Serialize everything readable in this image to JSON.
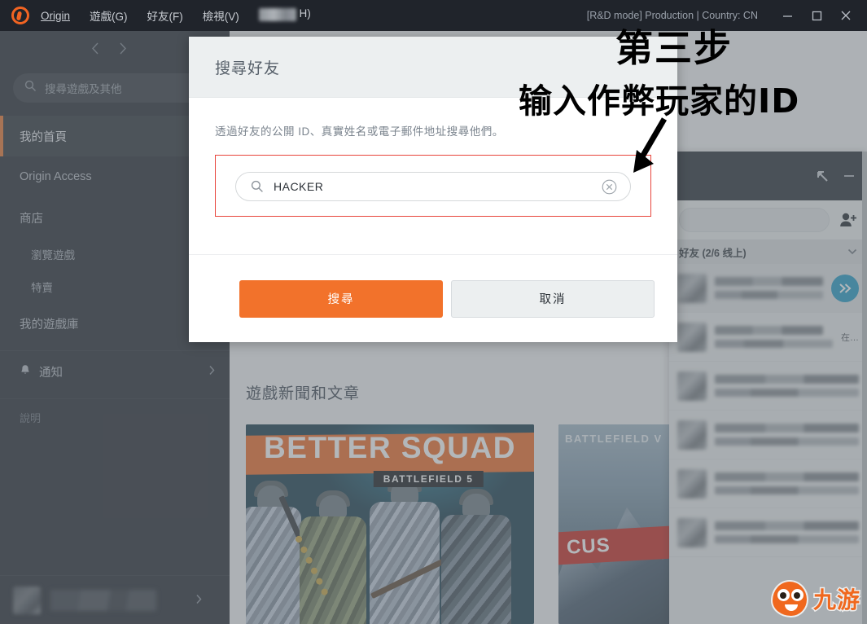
{
  "titlebar": {
    "app_name": "Origin",
    "menus": [
      {
        "label": "Origin",
        "accel": ""
      },
      {
        "label": "遊戲(G)",
        "accel": "G"
      },
      {
        "label": "好友(F)",
        "accel": "F"
      },
      {
        "label": "檢視(V)",
        "accel": "V"
      }
    ],
    "menu_blurred_tail": "H)",
    "status": "[R&D mode] Production | Country: CN",
    "window_controls": {
      "minimize": "minimize-icon",
      "maximize": "maximize-icon",
      "close": "close-icon"
    }
  },
  "sidebar": {
    "nav_back": "chevron-left-icon",
    "nav_forward": "chevron-right-icon",
    "search_placeholder": "搜尋遊戲及其他",
    "items": [
      {
        "label": "我的首頁",
        "active": true,
        "sub": false
      },
      {
        "label": "Origin Access",
        "active": false,
        "sub": false
      },
      {
        "label": "商店",
        "active": false,
        "sub": false
      },
      {
        "label": "瀏覽遊戲",
        "active": false,
        "sub": true
      },
      {
        "label": "特賣",
        "active": false,
        "sub": true
      },
      {
        "label": "我的遊戲庫",
        "active": false,
        "sub": false
      }
    ],
    "notifications": {
      "label": "通知",
      "icon": "bell-icon",
      "chevron": "chevron-right-icon"
    },
    "help": {
      "label": "說明"
    },
    "user_chevron": "chevron-right-icon"
  },
  "main": {
    "news_heading": "遊戲新聞和文章",
    "cards": [
      {
        "banner": "BETTER SQUAD",
        "subtitle": "BATTLEFIELD 5"
      },
      {
        "banner": "BATTLEFIELD V",
        "subtitle": "CUS"
      }
    ]
  },
  "friends_panel": {
    "restore_icon": "restore-arrow-icon",
    "minimize_icon": "minimize-icon",
    "search_value": "",
    "add_friend_icon": "add-friend-icon",
    "group_label": "好友 (2/6 线上)",
    "group_chevron": "chevron-down-icon",
    "rows": [
      {
        "name_prefix": "bW",
        "status_prefix": "遊",
        "chat_icon": "double-chevron-icon"
      },
      {
        "name_prefix": "",
        "status_suffix": "在…",
        "chat_icon": ""
      },
      {
        "name_prefix": "",
        "status_suffix": "",
        "chat_icon": ""
      },
      {
        "name_prefix": "",
        "status_suffix": "",
        "chat_icon": ""
      },
      {
        "name_prefix": "",
        "status_suffix": "",
        "chat_icon": ""
      },
      {
        "name_prefix": "",
        "status_suffix": "",
        "chat_icon": ""
      }
    ]
  },
  "modal": {
    "title": "搜尋好友",
    "description": "透過好友的公開 ID、真實姓名或電子郵件地址搜尋他們。",
    "search_icon": "search-icon",
    "search_value": "HACKER",
    "clear_icon": "clear-icon",
    "primary_button": "搜尋",
    "secondary_button": "取消",
    "highlight_color": "#e8453c",
    "primary_color": "#f2722b"
  },
  "annotation": {
    "line1": "第三步",
    "line2": "输入作弊玩家的ID",
    "arrow": "arrow-down-left-icon"
  },
  "watermark": {
    "text": "九游",
    "logo": "jiuyou-mascot-icon"
  }
}
